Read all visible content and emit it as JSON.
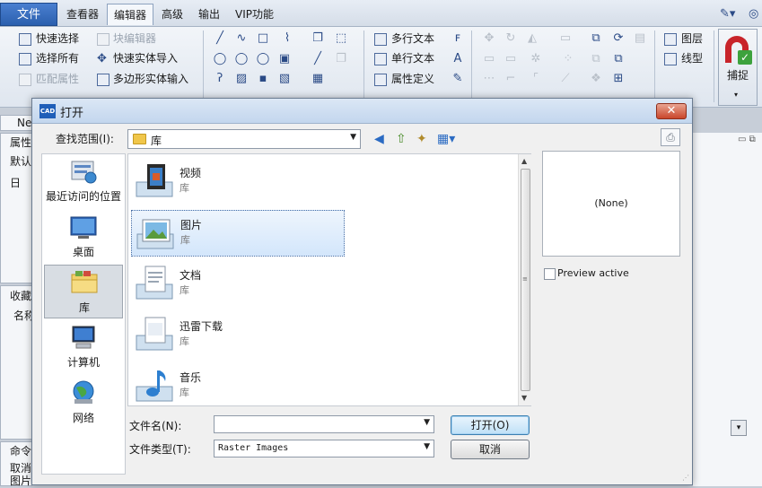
{
  "menubar": {
    "file": "文件",
    "tabs": [
      "查看器",
      "编辑器",
      "高级",
      "输出",
      "VIP功能"
    ]
  },
  "ribbon": {
    "select": {
      "quick_select": "快速选择",
      "select_all": "选择所有",
      "match_props": "匹配属性",
      "block_editor": "块编辑器",
      "quick_entity_import": "快速实体导入",
      "polygon_entity_input": "多边形实体输入"
    },
    "text": {
      "mtext": "多行文本",
      "stext": "单行文本",
      "attdef": "属性定义"
    },
    "layer": "图层",
    "linetype": "线型",
    "capture": "捕捉"
  },
  "background": {
    "ne_tab": "Ne",
    "props": "属性",
    "default": "默认",
    "minus": "日",
    "fav": "收藏",
    "name": "名称",
    "cmd": "命令",
    "cancel": "取消",
    "image": "图片"
  },
  "dialog": {
    "title": "打开",
    "lookin_label": "查找范围(I):",
    "lookin_value": "库",
    "places": [
      "最近访问的位置",
      "桌面",
      "库",
      "计算机",
      "网络"
    ],
    "files": [
      {
        "name": "视频",
        "type": "库"
      },
      {
        "name": "图片",
        "type": "库"
      },
      {
        "name": "文档",
        "type": "库"
      },
      {
        "name": "迅雷下载",
        "type": "库"
      },
      {
        "name": "音乐",
        "type": "库"
      }
    ],
    "preview_text": "(None)",
    "preview_active": "Preview active",
    "filename_label": "文件名(N):",
    "filename_value": "",
    "filetype_label": "文件类型(T):",
    "filetype_value": "Raster Images",
    "open_button": "打开(O)",
    "cancel_button": "取消"
  }
}
